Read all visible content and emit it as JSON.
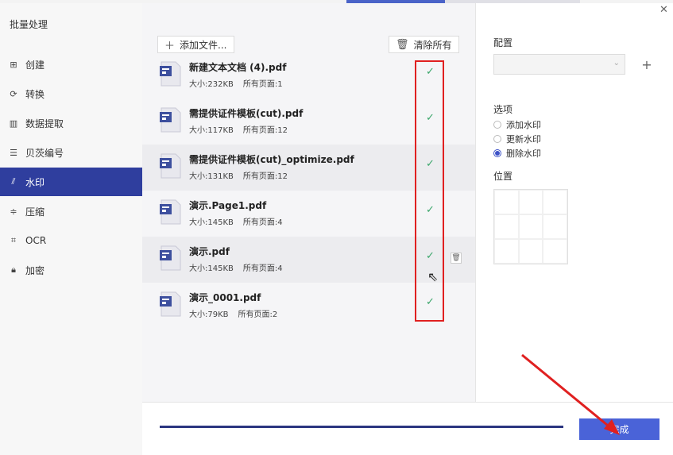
{
  "sidebar": {
    "title": "批量处理",
    "items": [
      {
        "label": "创建",
        "icon": "create-icon"
      },
      {
        "label": "转换",
        "icon": "convert-icon"
      },
      {
        "label": "数据提取",
        "icon": "chart-icon"
      },
      {
        "label": "贝茨编号",
        "icon": "list-number-icon"
      },
      {
        "label": "水印",
        "icon": "watermark-icon",
        "active": true
      },
      {
        "label": "压缩",
        "icon": "compress-icon"
      },
      {
        "label": "OCR",
        "icon": "ocr-icon"
      },
      {
        "label": "加密",
        "icon": "lock-icon"
      }
    ]
  },
  "toolbar": {
    "add_files_label": "添加文件...",
    "clear_all_label": "清除所有"
  },
  "files": [
    {
      "name": "新建文本文档 (4).pdf",
      "size": "大小:232KB",
      "pages": "所有页面:1"
    },
    {
      "name": "需提供证件模板(cut).pdf",
      "size": "大小:117KB",
      "pages": "所有页面:12"
    },
    {
      "name": "需提供证件模板(cut)_optimize.pdf",
      "size": "大小:131KB",
      "pages": "所有页面:12"
    },
    {
      "name": "演示.Page1.pdf",
      "size": "大小:145KB",
      "pages": "所有页面:4"
    },
    {
      "name": "演示.pdf",
      "size": "大小:145KB",
      "pages": "所有页面:4"
    },
    {
      "name": "演示_0001.pdf",
      "size": "大小:79KB",
      "pages": "所有页面:2"
    }
  ],
  "settings": {
    "config_label": "配置",
    "options_label": "选项",
    "options": [
      {
        "label": "添加水印",
        "selected": false
      },
      {
        "label": "更新水印",
        "selected": false
      },
      {
        "label": "删除水印",
        "selected": true
      }
    ],
    "position_label": "位置"
  },
  "footer": {
    "done_label": "完成",
    "progress": 1.0
  },
  "colors": {
    "accent": "#2f3e9e",
    "button": "#4a63d8",
    "check": "#3aa66a",
    "highlight": "#e02020"
  }
}
